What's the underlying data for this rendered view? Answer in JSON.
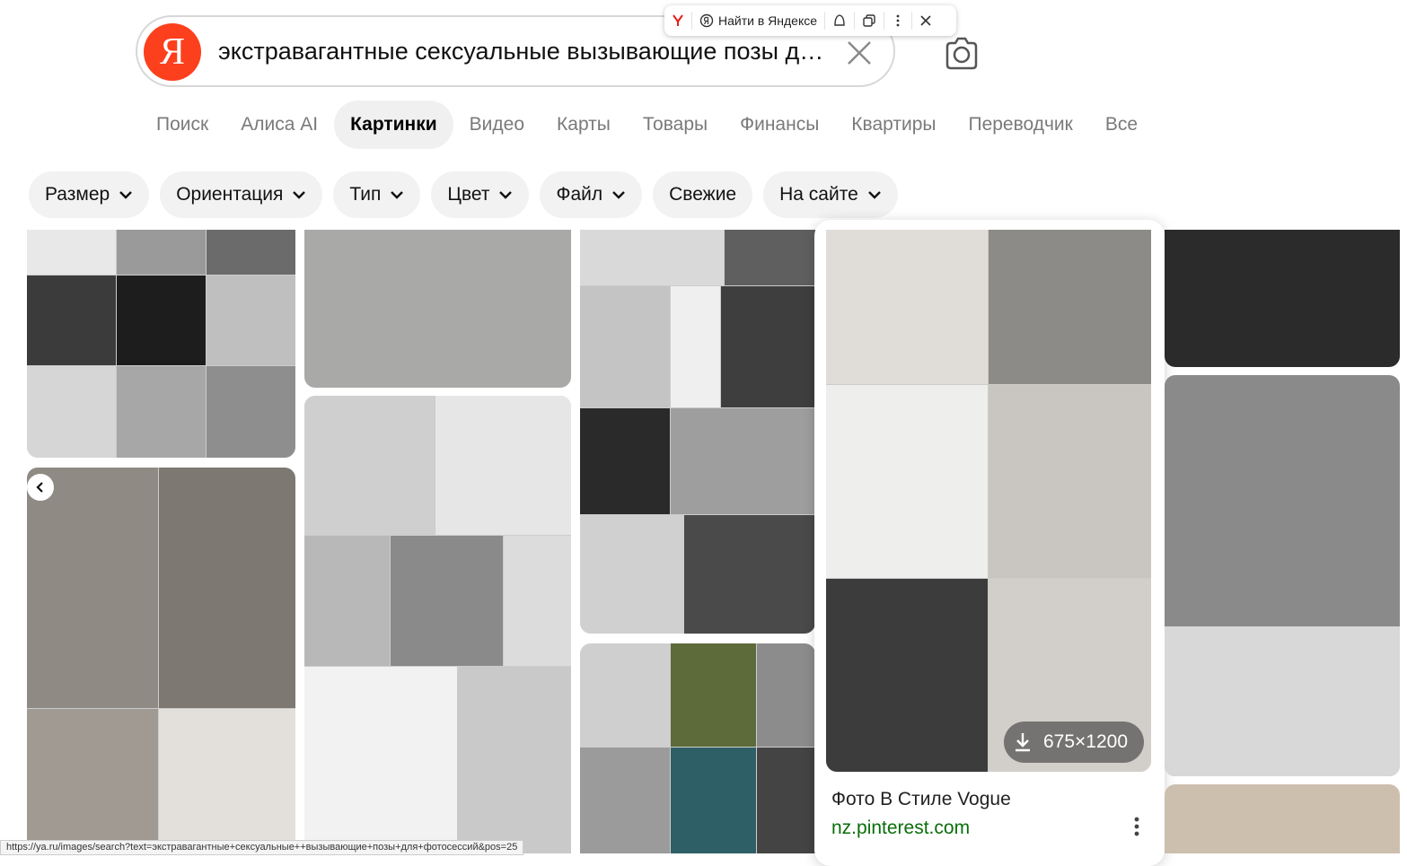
{
  "search": {
    "logo_letter": "Я",
    "query": "экстравагантные сексуальные  вызывающие позы для фотосессий"
  },
  "browser_panel": {
    "find_label": "Найти в Яндексе"
  },
  "nav": {
    "tabs": [
      {
        "label": "Поиск"
      },
      {
        "label": "Алиса AI"
      },
      {
        "label": "Картинки",
        "active": true
      },
      {
        "label": "Видео"
      },
      {
        "label": "Карты"
      },
      {
        "label": "Товары"
      },
      {
        "label": "Финансы"
      },
      {
        "label": "Квартиры"
      },
      {
        "label": "Переводчик"
      },
      {
        "label": "Все"
      }
    ]
  },
  "filters": [
    {
      "label": "Размер",
      "dropdown": true
    },
    {
      "label": "Ориентация",
      "dropdown": true
    },
    {
      "label": "Тип",
      "dropdown": true
    },
    {
      "label": "Цвет",
      "dropdown": true
    },
    {
      "label": "Файл",
      "dropdown": true
    },
    {
      "label": "Свежие",
      "dropdown": false
    },
    {
      "label": "На сайте",
      "dropdown": true
    }
  ],
  "selected_card": {
    "title": "Фото В Стиле Vogue",
    "source": "nz.pinterest.com",
    "size": "675×1200"
  },
  "status_bar": {
    "url": "https://ya.ru/images/search?text=экстравагантные+сексуальные++вызывающие+позы+для+фотосессий&pos=25"
  },
  "colors": {
    "brand": "#fc3f1d",
    "source_link": "#0a6e0a",
    "chip_bg": "#f2f2f2"
  }
}
